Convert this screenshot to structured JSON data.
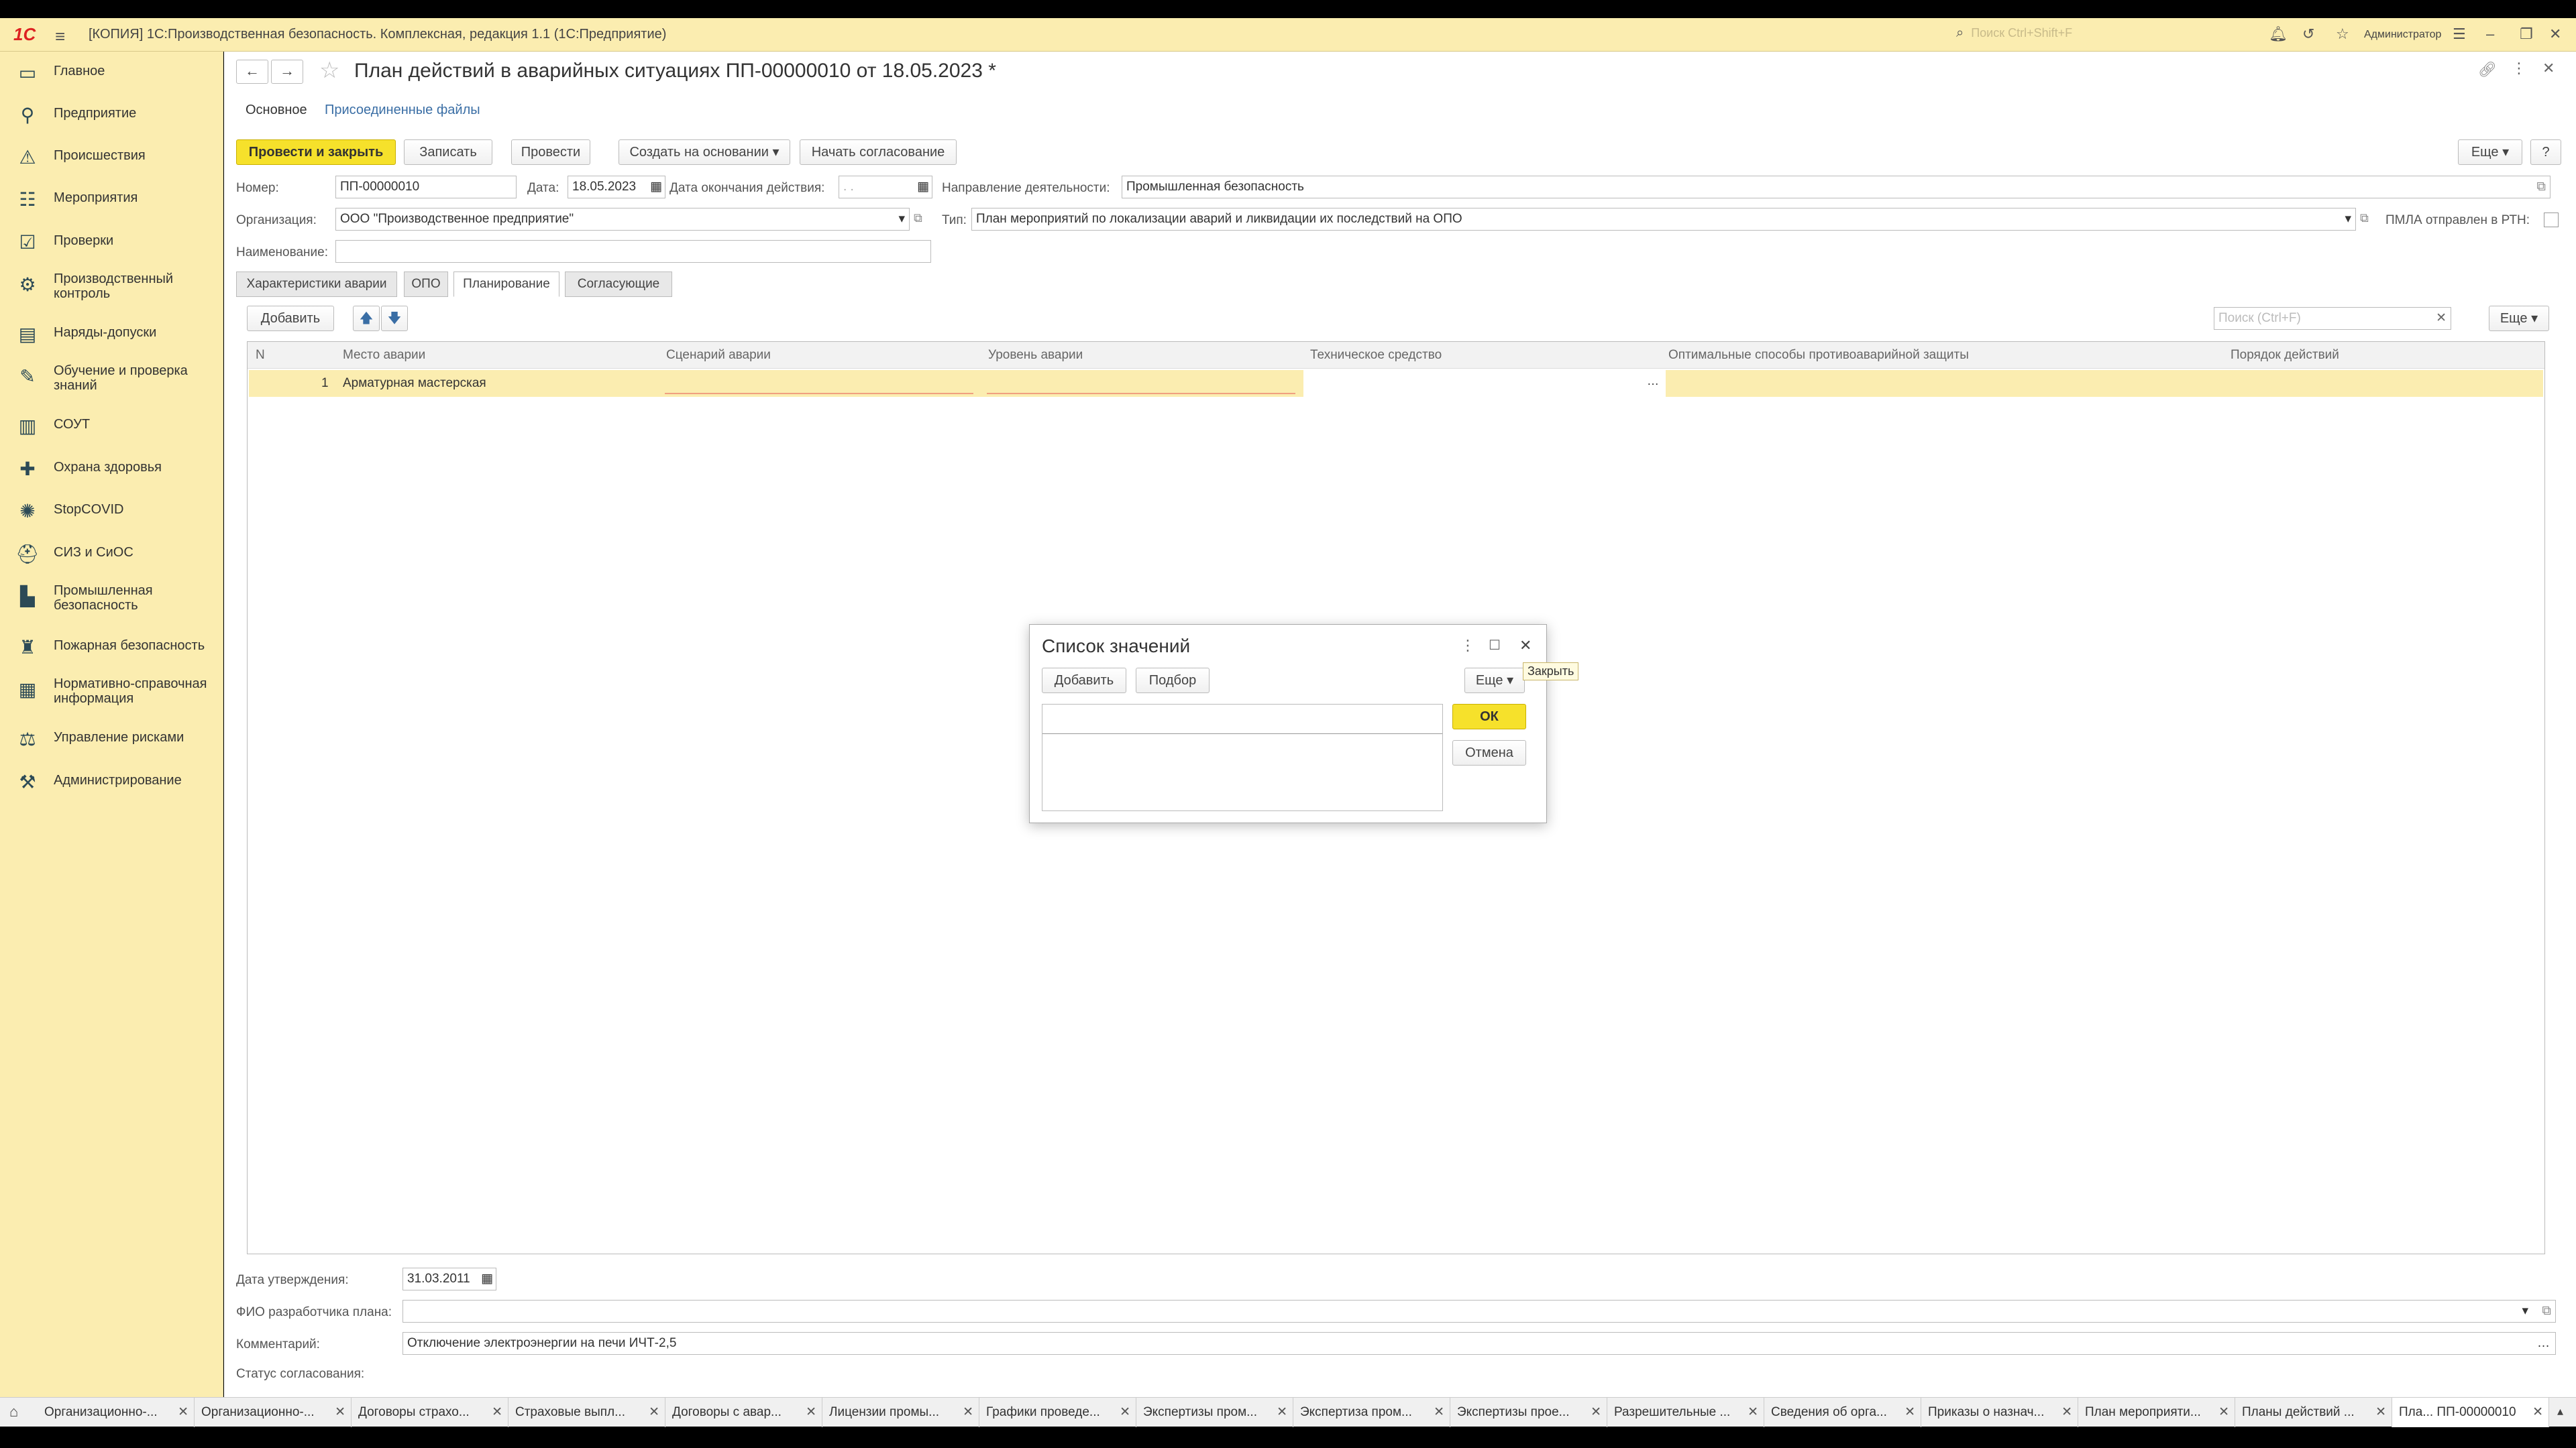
{
  "titlebar": {
    "logo": "1С",
    "app_title": "[КОПИЯ] 1С:Производственная безопасность. Комплексная, редакция 1.1  (1С:Предприятие)",
    "search_placeholder": "Поиск Ctrl+Shift+F",
    "user": "Администратор"
  },
  "sidebar": {
    "items": [
      {
        "label": "Главное",
        "icon": "home-icon"
      },
      {
        "label": "Предприятие",
        "icon": "org-structure-icon"
      },
      {
        "label": "Происшествия",
        "icon": "warning-triangle-icon"
      },
      {
        "label": "Мероприятия",
        "icon": "list-icon"
      },
      {
        "label": "Проверки",
        "icon": "checklist-icon"
      },
      {
        "label": "Производственный контроль",
        "icon": "control-icon"
      },
      {
        "label": "Наряды-допуски",
        "icon": "permit-icon"
      },
      {
        "label": "Обучение и проверка знаний",
        "icon": "education-icon"
      },
      {
        "label": "СОУТ",
        "icon": "document-icon"
      },
      {
        "label": "Охрана здоровья",
        "icon": "health-icon"
      },
      {
        "label": "StopCOVID",
        "icon": "virus-icon"
      },
      {
        "label": "СИЗ и СиОС",
        "icon": "helmet-icon"
      },
      {
        "label": "Промышленная безопасность",
        "icon": "industry-icon"
      },
      {
        "label": "Пожарная безопасность",
        "icon": "fire-extinguisher-icon"
      },
      {
        "label": "Нормативно-справочная информация",
        "icon": "reference-icon"
      },
      {
        "label": "Управление рисками",
        "icon": "risk-icon"
      },
      {
        "label": "Администрирование",
        "icon": "admin-icon"
      }
    ]
  },
  "document": {
    "title": "План действий в аварийных ситуациях ПП-00000010 от 18.05.2023 *",
    "tabs_top": [
      "Основное",
      "Присоединенные файлы"
    ],
    "toolbar": {
      "post_close": "Провести и закрыть",
      "save": "Записать",
      "post": "Провести",
      "create_based": "Создать на основании",
      "start_approval": "Начать согласование",
      "more": "Еще",
      "help": "?"
    },
    "fields": {
      "number_label": "Номер:",
      "number_value": "ПП-00000010",
      "date_label": "Дата:",
      "date_value": "18.05.2023",
      "end_date_label": "Дата окончания действия:",
      "end_date_value": " .  .",
      "direction_label": "Направление деятельности:",
      "direction_value": "Промышленная безопасность",
      "org_label": "Организация:",
      "org_value": "ООО \"Производственное предприятие\"",
      "type_label": "Тип:",
      "type_value": "План мероприятий по локализации аварий и ликвидации их последствий на ОПО",
      "pmla_label": "ПМЛА отправлен в РТН:",
      "name_label": "Наименование:",
      "name_value": ""
    },
    "inner_tabs": [
      "Характеристики аварии",
      "ОПО",
      "Планирование",
      "Согласующие"
    ],
    "table_toolbar": {
      "add": "Добавить",
      "search_placeholder": "Поиск (Ctrl+F)",
      "more": "Еще"
    },
    "table": {
      "columns": [
        "N",
        "Место аварии",
        "Сценарий аварии",
        "Уровень аварии",
        "Техническое средство",
        "Оптимальные способы противоаварийной защиты",
        "Порядок действий"
      ],
      "rows": [
        {
          "n": "1",
          "place": "Арматурная мастерская",
          "scenario": "",
          "level": "",
          "tech": "",
          "methods": "",
          "order": ""
        }
      ]
    },
    "bottom": {
      "approval_date_label": "Дата утверждения:",
      "approval_date_value": "31.03.2011",
      "developer_label": "ФИО разработчика плана:",
      "developer_value": "",
      "comment_label": "Комментарий:",
      "comment_value": "Отключение электроэнергии на печи ИЧТ-2,5",
      "status_label": "Статус согласования:"
    }
  },
  "dialog": {
    "title": "Список значений",
    "add": "Добавить",
    "pick": "Подбор",
    "more": "Еще",
    "ok": "ОК",
    "cancel": "Отмена",
    "tooltip": "Закрыть"
  },
  "taskbar": {
    "tabs": [
      "Организационно-...",
      "Организационно-...",
      "Договоры страхо...",
      "Страховые выпл...",
      "Договоры с авар...",
      "Лицензии промы...",
      "Графики проведе...",
      "Экспертизы пром...",
      "Экспертиза пром...",
      "Экспертизы прое...",
      "Разрешительные ...",
      "Сведения об орга...",
      "Приказы о назнач...",
      "План мероприяти...",
      "Планы действий ...",
      "Пла... ПП-00000010"
    ]
  },
  "colors": {
    "accent": "#f6e12b",
    "panel": "#fbedb0",
    "link": "#3a6ea5"
  }
}
